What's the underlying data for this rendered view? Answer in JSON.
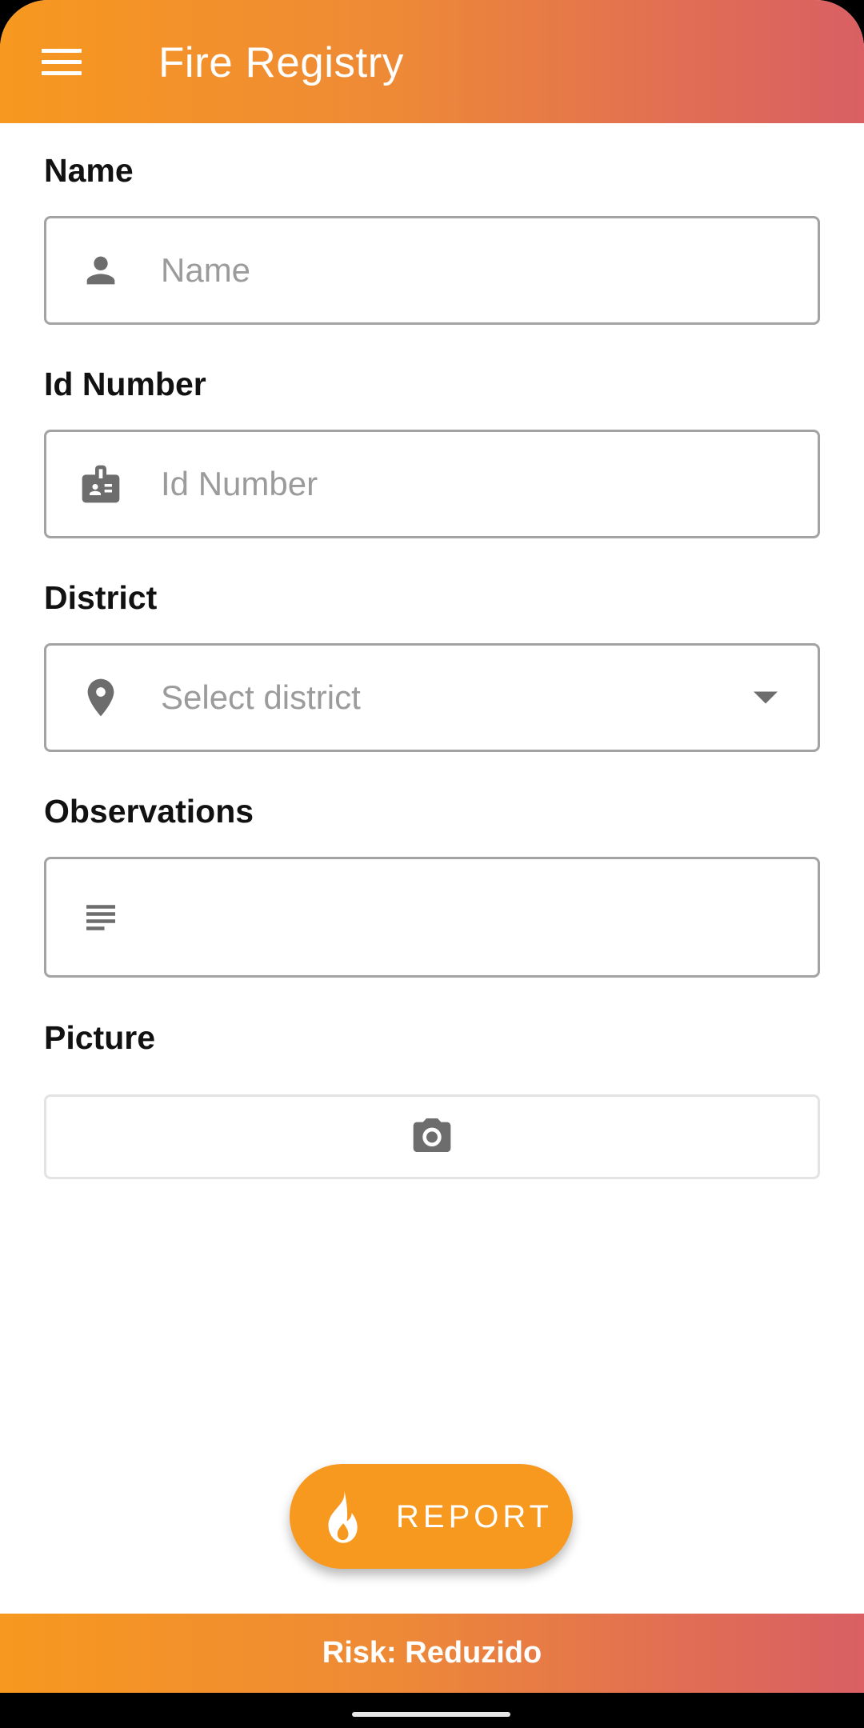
{
  "app_bar": {
    "title": "Fire Registry",
    "menu_icon": "hamburger-menu-icon"
  },
  "form": {
    "name": {
      "label": "Name",
      "placeholder": "Name",
      "icon": "person-icon"
    },
    "id_number": {
      "label": "Id Number",
      "placeholder": "Id Number",
      "icon": "badge-icon"
    },
    "district": {
      "label": "District",
      "placeholder": "Select district",
      "icon": "location-pin-icon",
      "dropdown_icon": "caret-down-icon"
    },
    "observations": {
      "label": "Observations",
      "value": "",
      "icon": "notes-icon"
    },
    "picture": {
      "label": "Picture",
      "icon": "camera-icon"
    }
  },
  "report_button": {
    "label": "REPORT",
    "icon": "fire-icon"
  },
  "risk_bar": {
    "text": "Risk: Reduzido"
  },
  "colors": {
    "accent": "#f7981f",
    "gradient_end": "#d95f63",
    "icon_grey": "#6d6d6d",
    "placeholder_grey": "#9b9b9b"
  }
}
